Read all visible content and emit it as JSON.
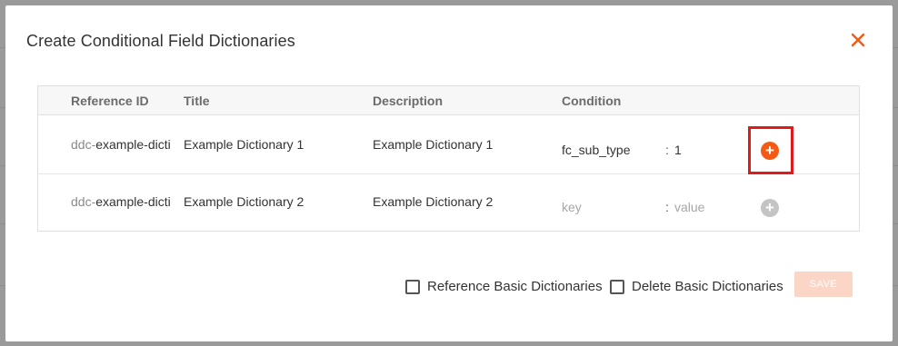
{
  "dialog": {
    "title": "Create Conditional Field Dictionaries",
    "close_icon": "close-icon"
  },
  "table": {
    "columns": [
      "Reference ID",
      "Title",
      "Description",
      "Condition"
    ],
    "rows": [
      {
        "ref_prefix": "ddc-",
        "ref_value": "example-dicti",
        "title": "Example Dictionary 1",
        "description": "Example Dictionary 1",
        "condition_key": "fc_sub_type",
        "condition_sep": ":",
        "condition_value": "1",
        "add_icon": "plus-circle-icon",
        "add_state": "active"
      },
      {
        "ref_prefix": "ddc-",
        "ref_value": "example-dicti",
        "title": "Example Dictionary 2",
        "description": "Example Dictionary 2",
        "condition_key_placeholder": "key",
        "condition_sep": ":",
        "condition_value_placeholder": "value",
        "add_icon": "plus-circle-icon",
        "add_state": "disabled"
      }
    ]
  },
  "footer": {
    "reference_basic_label": "Reference Basic Dictionaries",
    "reference_basic_checked": false,
    "delete_basic_label": "Delete Basic Dictionaries",
    "delete_basic_checked": false,
    "save_label": "SAVE"
  },
  "colors": {
    "accent": "#f55a14",
    "highlight": "#e11b1b",
    "save_disabled": "#fbd5c5"
  }
}
